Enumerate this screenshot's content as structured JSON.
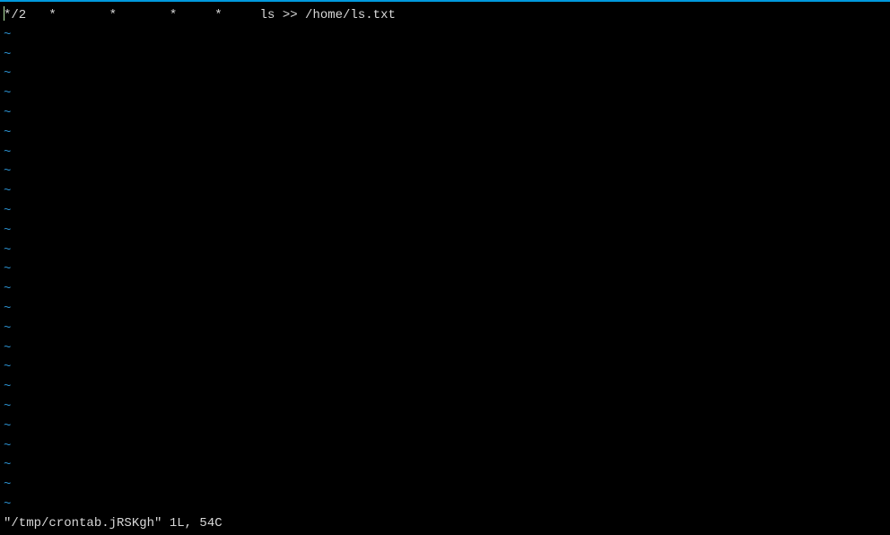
{
  "editor": {
    "content_line": "*/2   *       *       *     *     ls >> /home/ls.txt",
    "tilde": "~",
    "tilde_count": 25
  },
  "status": {
    "text": "\"/tmp/crontab.jRSKgh\" 1L, 54C"
  }
}
